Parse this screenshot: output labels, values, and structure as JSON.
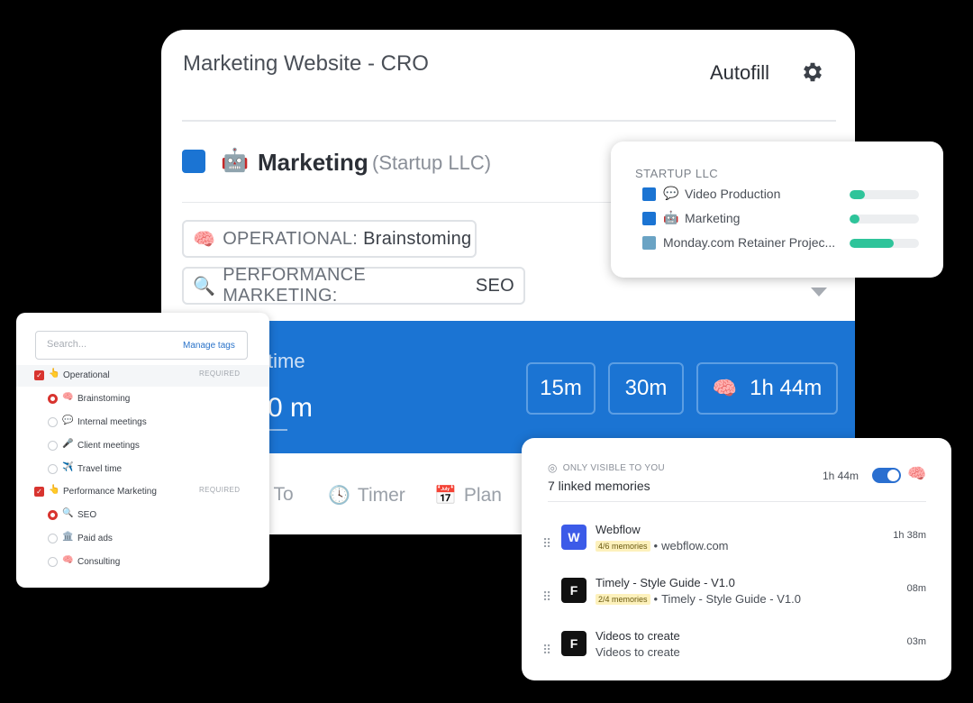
{
  "main": {
    "title": "Marketing Website - CRO",
    "autofill": "Autofill",
    "project": {
      "emoji": "🤖",
      "name": "Marketing",
      "client": "(Startup LLC)",
      "color": "#1b74d3"
    },
    "tags": [
      {
        "emoji": "🧠",
        "group": "OPERATIONAL:",
        "name": "Brainstoming"
      },
      {
        "emoji": "🔍",
        "group": "PERFORMANCE MARKETING:",
        "name": "SEO"
      }
    ],
    "time_label": "time",
    "time_value": "0 m",
    "durations": [
      "15m",
      "30m",
      "1h 44m"
    ],
    "tabs": [
      {
        "icon": "",
        "label": "& To"
      },
      {
        "icon": "🕓",
        "label": "Timer"
      },
      {
        "icon": "📅",
        "label": "Plan"
      }
    ]
  },
  "tag_picker": {
    "search_placeholder": "Search...",
    "manage_tags": "Manage tags",
    "required": "REQUIRED",
    "groups": [
      {
        "emoji": "👆",
        "label": "Operational",
        "items": [
          {
            "emoji": "🧠",
            "label": "Brainstoming",
            "selected": true
          },
          {
            "emoji": "💬",
            "label": "Internal meetings",
            "selected": false
          },
          {
            "emoji": "🎤",
            "label": "Client meetings",
            "selected": false
          },
          {
            "emoji": "✈️",
            "label": "Travel time",
            "selected": false
          }
        ]
      },
      {
        "emoji": "👆",
        "label": "Performance Marketing",
        "items": [
          {
            "emoji": "🔍",
            "label": "SEO",
            "selected": true
          },
          {
            "emoji": "🏛️",
            "label": "Paid ads",
            "selected": false
          },
          {
            "emoji": "🧠",
            "label": "Consulting",
            "selected": false
          }
        ]
      }
    ]
  },
  "client_popup": {
    "heading": "STARTUP LLC",
    "projects": [
      {
        "emoji": "💬",
        "name": "Video Production",
        "progress": 0.22,
        "color": "#1b74d3"
      },
      {
        "emoji": "🤖",
        "name": "Marketing",
        "progress": 0.14,
        "color": "#1b74d3"
      },
      {
        "emoji": "",
        "name": "Monday.com Retainer Projec...",
        "progress": 0.64,
        "color": "#6aa3c4"
      }
    ]
  },
  "memories": {
    "visibility": "ONLY VISIBLE TO YOU",
    "linked": "7 linked memories",
    "total": "1h 44m",
    "toggle_on": true,
    "items": [
      {
        "app": "W",
        "app_class": "wf",
        "title": "Webflow",
        "badge": "4/6 memories",
        "sub": "webflow.com",
        "duration": "1h 38m"
      },
      {
        "app": "F",
        "app_class": "fg",
        "title": "Timely - Style Guide - V1.0",
        "badge": "2/4 memories",
        "sub": "Timely - Style Guide - V1.0",
        "duration": "08m"
      },
      {
        "app": "F",
        "app_class": "fg",
        "title": "Videos to create",
        "badge": "",
        "sub": "Videos to create",
        "duration": "03m"
      }
    ]
  }
}
